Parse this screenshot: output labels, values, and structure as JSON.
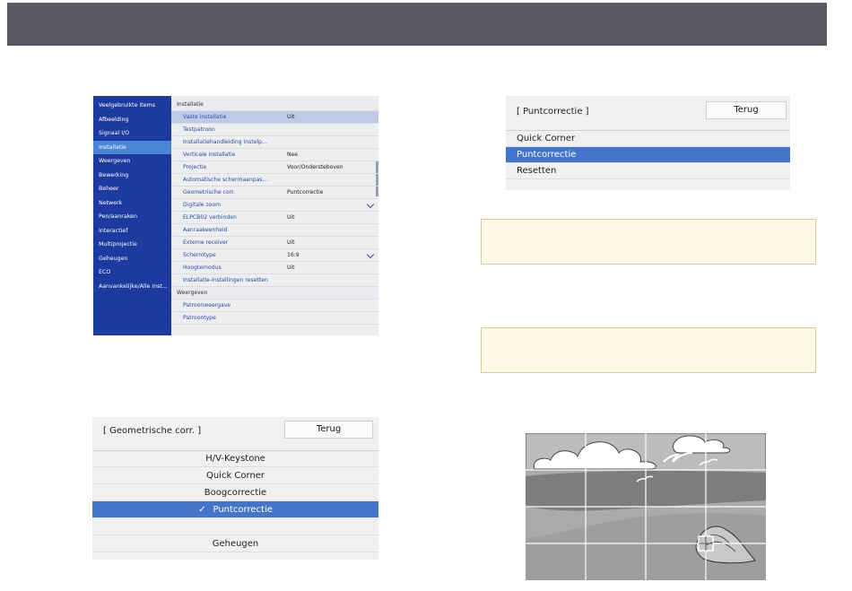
{
  "menu": {
    "nav": [
      "Veelgebruikte items",
      "Afbeelding",
      "Signaal I/O",
      "Installatie",
      "Weergeven",
      "Bewerking",
      "Beheer",
      "Netwerk",
      "Pen/aanraken",
      "Interactief",
      "Multiprojectie",
      "Geheugen",
      "ECO",
      "Aanvankelijke/Alle inst..."
    ],
    "active_nav": "Installatie",
    "rows": [
      {
        "label": "Installatie",
        "value": "",
        "section": true
      },
      {
        "label": "Vaste installatie",
        "value": "Uit",
        "selected": true
      },
      {
        "label": "Testpatroon",
        "value": ""
      },
      {
        "label": "Installatiehandleiding instelp...",
        "value": ""
      },
      {
        "label": "Verticale installatie",
        "value": "Nee"
      },
      {
        "label": "Projectie",
        "value": "Voor/Ondersteboven"
      },
      {
        "label": "Automatische schermaanpas...",
        "value": ""
      },
      {
        "label": "Geometrische corr.",
        "value": "Puntcorrectie"
      },
      {
        "label": "Digitale zoom",
        "value": "",
        "chevron": true
      },
      {
        "label": "ELPCB02 verbinden",
        "value": "Uit"
      },
      {
        "label": "Aanraakeenheid",
        "value": ""
      },
      {
        "label": "Externe receiver",
        "value": "Uit"
      },
      {
        "label": "Schermtype",
        "value": "16:9",
        "chevron": true
      },
      {
        "label": "Hoogtemodus",
        "value": "Uit"
      },
      {
        "label": "Installatie-instellingen resetten",
        "value": ""
      },
      {
        "label": "Weergeven",
        "value": "",
        "section": true
      },
      {
        "label": "Patroonweergave",
        "value": ""
      },
      {
        "label": "Patroontype",
        "value": ""
      }
    ]
  },
  "pc_dialog": {
    "title": "[ Puntcorrectie ]",
    "back": "Terug",
    "items": [
      "Quick Corner",
      "Puntcorrectie",
      "Resetten"
    ],
    "selected": "Puntcorrectie"
  },
  "gc_dialog": {
    "title": "[ Geometrische corr. ]",
    "back": "Terug",
    "items": [
      "H/V-Keystone",
      "Quick Corner",
      "Boogcorrectie",
      "Puntcorrectie",
      "",
      "Geheugen"
    ],
    "selected": "Puntcorrectie",
    "check": "✓"
  },
  "colors": {
    "header": "#595961",
    "nav_bg": "#1c3aa0",
    "nav_active": "#4a86d8",
    "selection": "#4575c9",
    "note_bg": "#fff8e6",
    "note_border": "#d9cc96"
  }
}
